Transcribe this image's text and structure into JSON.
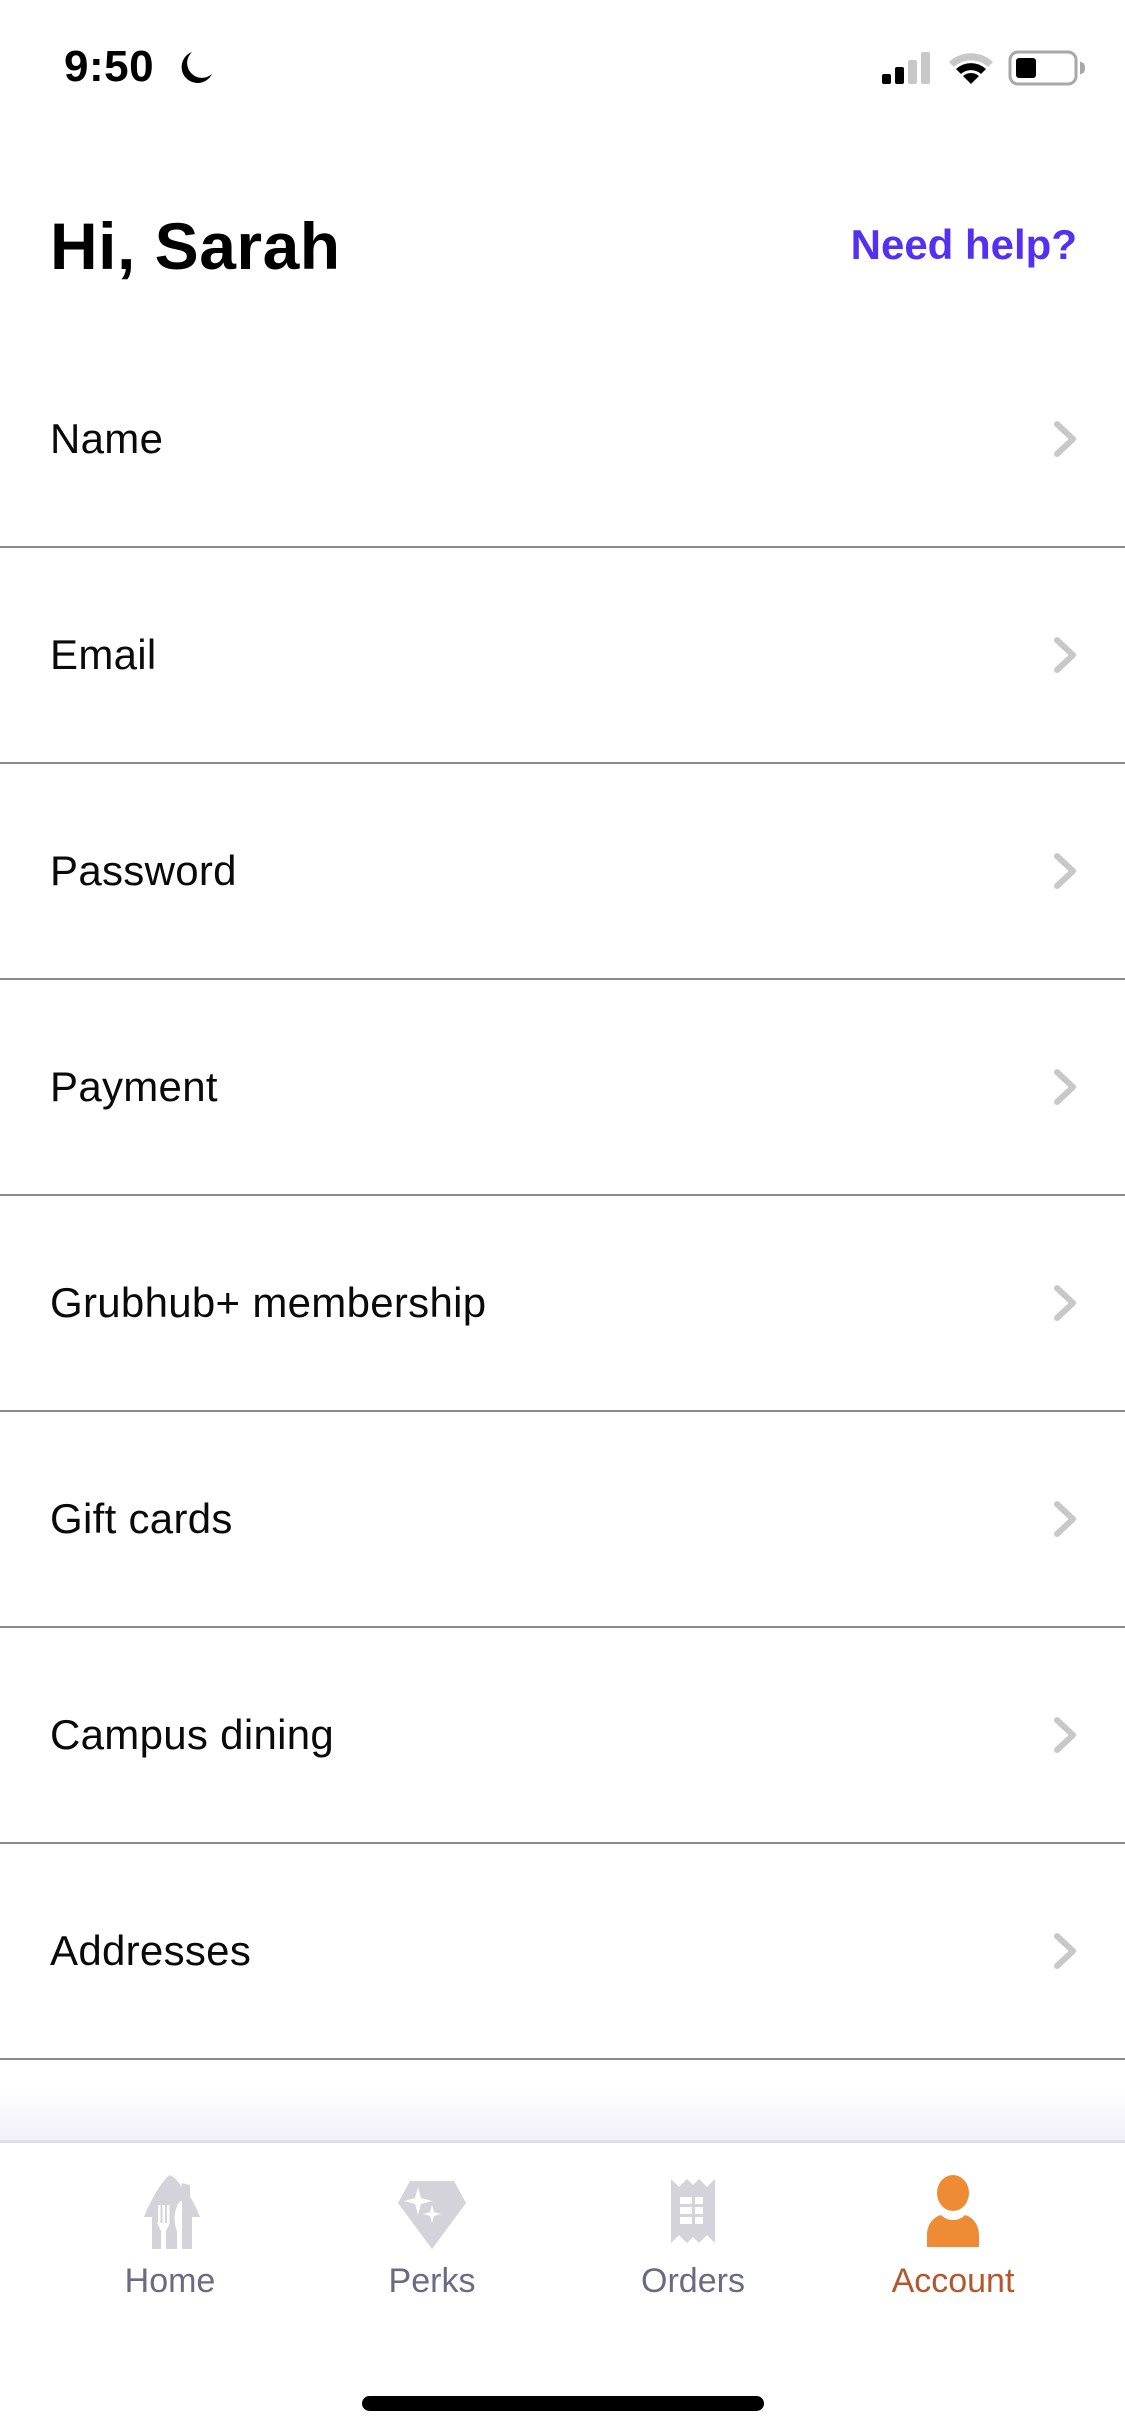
{
  "status_bar": {
    "time": "9:50",
    "focus_mode": "moon-icon",
    "signal_bars_active": 2,
    "signal_bars_total": 4,
    "battery_level_percent": 30
  },
  "header": {
    "greeting": "Hi, Sarah",
    "help_link": "Need help?"
  },
  "menu": {
    "items": [
      {
        "label": "Name"
      },
      {
        "label": "Email"
      },
      {
        "label": "Password"
      },
      {
        "label": "Payment"
      },
      {
        "label": "Grubhub+ membership"
      },
      {
        "label": "Gift cards"
      },
      {
        "label": "Campus dining"
      },
      {
        "label": "Addresses"
      }
    ]
  },
  "tab_bar": {
    "active": "Account",
    "tabs": [
      {
        "label": "Home",
        "icon": "home-fork-knife-icon"
      },
      {
        "label": "Perks",
        "icon": "diamond-sparkle-icon"
      },
      {
        "label": "Orders",
        "icon": "receipt-icon"
      },
      {
        "label": "Account",
        "icon": "person-icon"
      }
    ]
  },
  "colors": {
    "accent_link": "#5431F2",
    "active_tab_icon": "#EF8B35",
    "active_tab_label": "#B4572A",
    "inactive_tab_icon": "#D3D3D9",
    "inactive_tab_label": "#6B6A83",
    "divider": "#8C8C8C",
    "chevron": "#C8C8C8"
  }
}
